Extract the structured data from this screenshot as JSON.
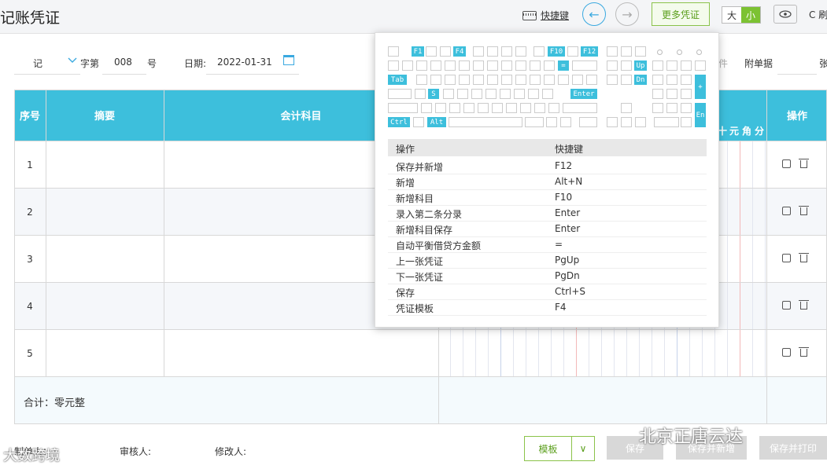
{
  "header": {
    "title": "记账凭证",
    "shortcut_label": "快捷键",
    "prev_icon": "←",
    "next_icon": "→",
    "more_vouchers": "更多凭证",
    "size_large": "大",
    "size_small": "小",
    "refresh_label": "C 刷"
  },
  "form": {
    "voucher_type": "记",
    "voucher_word": "字第",
    "voucher_no": "008",
    "voucher_no_suffix": "号",
    "date_label": "日期:",
    "date_value": "2022-01-31",
    "attachment_label": "件",
    "attached_docs_label": "附单据",
    "attached_docs_unit": "张"
  },
  "table": {
    "headers": {
      "seq": "序号",
      "summary": "摘要",
      "account": "会计科目",
      "operation": "操作"
    },
    "amount_units": [
      "十",
      "元",
      "角",
      "分"
    ],
    "rows": [
      "1",
      "2",
      "3",
      "4",
      "5"
    ],
    "total": "合计：零元整"
  },
  "footer": {
    "maker": "制单人：",
    "auditor": "审核人:",
    "modifier": "修改人:",
    "template": "模板",
    "template_arrow": "∨",
    "save": "保存",
    "save_new": "保存并新增",
    "save_print": "保存并打印"
  },
  "watermarks": {
    "left": "大数跨境",
    "right": "北京正唐云达"
  },
  "shortcut_popup": {
    "keys": {
      "f1": "F1",
      "f4": "F4",
      "f10": "F10",
      "f12": "F12",
      "eq": "=",
      "up": "Up",
      "dn": "Dn",
      "tab": "Tab",
      "s": "S",
      "enter": "Enter",
      "ctrl": "Ctrl",
      "alt": "Alt",
      "plus": "+",
      "en": "En"
    },
    "header": {
      "action": "操作",
      "key": "快捷键"
    },
    "rows": [
      {
        "action": "保存并新增",
        "key": "F12"
      },
      {
        "action": "新增",
        "key": "Alt+N"
      },
      {
        "action": "新增科目",
        "key": "F10"
      },
      {
        "action": "录入第二条分录",
        "key": "Enter"
      },
      {
        "action": "新增科目保存",
        "key": "Enter"
      },
      {
        "action": "自动平衡借贷方金额",
        "key": "="
      },
      {
        "action": "上一张凭证",
        "key": "PgUp"
      },
      {
        "action": "下一张凭证",
        "key": "PgDn"
      },
      {
        "action": "保存",
        "key": "Ctrl+S"
      },
      {
        "action": "凭证模板",
        "key": "F4"
      }
    ]
  }
}
